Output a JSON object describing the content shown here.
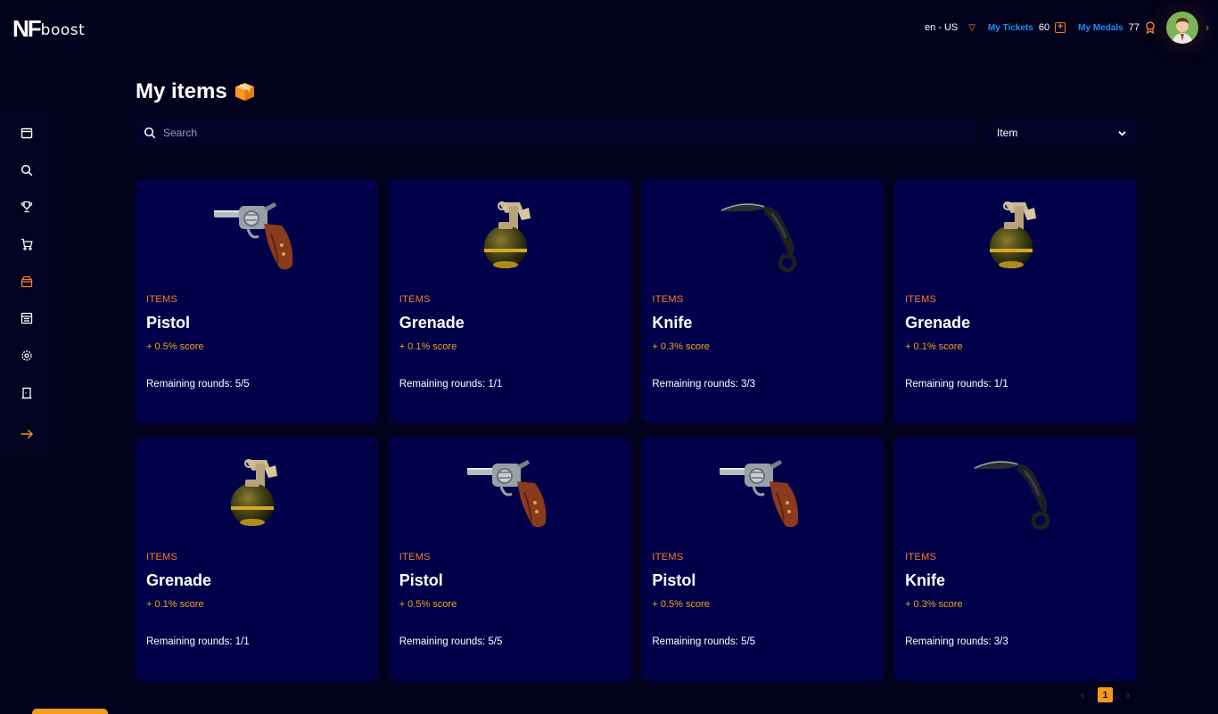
{
  "brand": {
    "mark": "NF",
    "name": "boost"
  },
  "header": {
    "language": "en - US",
    "tickets": {
      "label": "My Tickets",
      "value": "60"
    },
    "medals": {
      "label": "My Medals",
      "value": "77"
    }
  },
  "sidebar": {
    "items": [
      {
        "name": "calendar",
        "icon": "calendar-icon"
      },
      {
        "name": "search",
        "icon": "search-icon"
      },
      {
        "name": "trophy",
        "icon": "trophy-icon"
      },
      {
        "name": "cart",
        "icon": "cart-icon"
      },
      {
        "name": "my-items",
        "icon": "box-icon",
        "active": true
      },
      {
        "name": "dashboard",
        "icon": "grid-icon"
      },
      {
        "name": "settings",
        "icon": "gear-icon"
      },
      {
        "name": "logout",
        "icon": "door-icon"
      },
      {
        "name": "expand",
        "icon": "arrow-right-icon"
      }
    ]
  },
  "main": {
    "title": "My items",
    "search_placeholder": "Search",
    "filter_selected": "Item"
  },
  "items": [
    {
      "category": "ITEMS",
      "name": "Pistol",
      "score": "+ 0.5% score",
      "rounds": "Remaining rounds: 5/5",
      "image": "pistol"
    },
    {
      "category": "ITEMS",
      "name": "Grenade",
      "score": "+ 0.1% score",
      "rounds": "Remaining rounds: 1/1",
      "image": "grenade"
    },
    {
      "category": "ITEMS",
      "name": "Knife",
      "score": "+ 0.3% score",
      "rounds": "Remaining rounds: 3/3",
      "image": "knife"
    },
    {
      "category": "ITEMS",
      "name": "Grenade",
      "score": "+ 0.1% score",
      "rounds": "Remaining rounds: 1/1",
      "image": "grenade"
    },
    {
      "category": "ITEMS",
      "name": "Grenade",
      "score": "+ 0.1% score",
      "rounds": "Remaining rounds: 1/1",
      "image": "grenade"
    },
    {
      "category": "ITEMS",
      "name": "Pistol",
      "score": "+ 0.5% score",
      "rounds": "Remaining rounds: 5/5",
      "image": "pistol"
    },
    {
      "category": "ITEMS",
      "name": "Pistol",
      "score": "+ 0.5% score",
      "rounds": "Remaining rounds: 5/5",
      "image": "pistol"
    },
    {
      "category": "ITEMS",
      "name": "Knife",
      "score": "+ 0.3% score",
      "rounds": "Remaining rounds: 3/3",
      "image": "knife"
    }
  ],
  "pagination": {
    "current": "1",
    "prev": "‹",
    "next": "›"
  },
  "colors": {
    "accent": "#f57f29",
    "score": "#f0a21b",
    "link": "#1e8ff0",
    "card": "#01014a",
    "background": "#02021c"
  }
}
